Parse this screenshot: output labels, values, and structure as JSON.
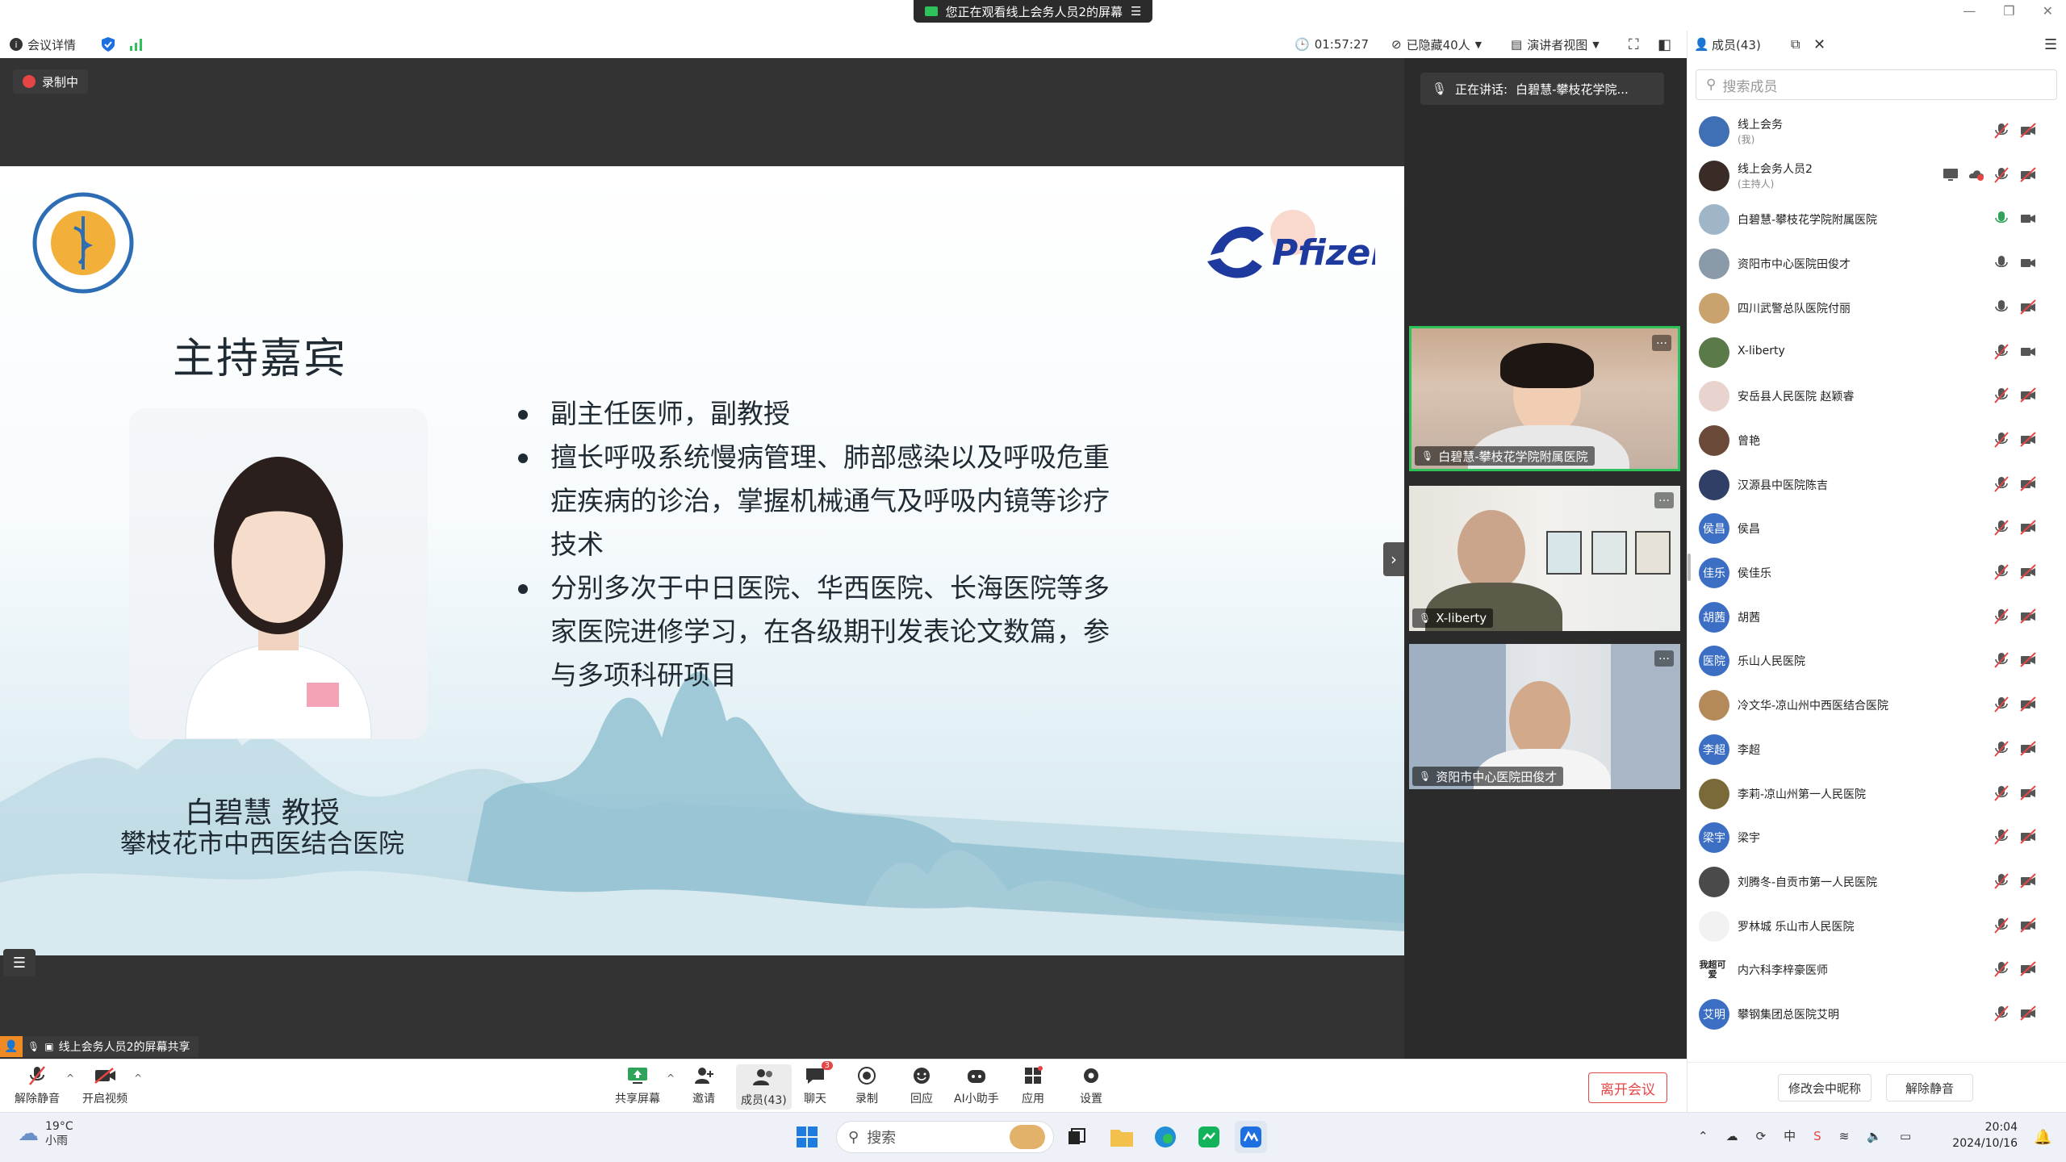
{
  "share_banner": {
    "text": "您正在观看线上会务人员2的屏幕",
    "menu_icon": "menu-icon"
  },
  "meeting_bar": {
    "info": "会议详情",
    "timer": "01:57:27",
    "hidden": "已隐藏40人",
    "view": "演讲者视图"
  },
  "panel": {
    "title": "成员(43)",
    "search_placeholder": "搜索成员",
    "members": [
      {
        "name": "线上会务",
        "sub": "(我)",
        "avatar": "",
        "color": "#3f6fb5",
        "mic": "muted",
        "cam": "off"
      },
      {
        "name": "线上会务人员2",
        "sub": "(主持人)",
        "avatar": "",
        "color": "#3a2b26",
        "mic": "muted",
        "cam": "off",
        "share": true
      },
      {
        "name": "白碧慧-攀枝花学院附属医院",
        "sub": "",
        "avatar": "",
        "color": "#9fb6c9",
        "mic": "on-green",
        "cam": "on"
      },
      {
        "name": "资阳市中心医院田俊才",
        "sub": "",
        "avatar": "",
        "color": "#8a9aa8",
        "mic": "on",
        "cam": "on"
      },
      {
        "name": "四川武警总队医院付丽",
        "sub": "",
        "avatar": "",
        "color": "#c9a26e",
        "mic": "on",
        "cam": "off"
      },
      {
        "name": "X-liberty",
        "sub": "",
        "avatar": "",
        "color": "#5a7a4a",
        "mic": "muted",
        "cam": "on"
      },
      {
        "name": "安岳县人民医院 赵颖睿",
        "sub": "",
        "avatar": "",
        "color": "#e9d3cf",
        "mic": "muted",
        "cam": "off"
      },
      {
        "name": "曾艳",
        "sub": "",
        "avatar": "",
        "color": "#6b4a3a",
        "mic": "muted",
        "cam": "off"
      },
      {
        "name": "汉源县中医院陈吉",
        "sub": "",
        "avatar": "",
        "color": "#2f3f66",
        "mic": "muted",
        "cam": "off"
      },
      {
        "name": "侯昌",
        "sub": "",
        "avatar": "侯昌",
        "color": "#3c6fc4",
        "mic": "muted",
        "cam": "off"
      },
      {
        "name": "侯佳乐",
        "sub": "",
        "avatar": "佳乐",
        "color": "#3c6fc4",
        "mic": "muted",
        "cam": "off"
      },
      {
        "name": "胡茜",
        "sub": "",
        "avatar": "胡茜",
        "color": "#3c6fc4",
        "mic": "muted",
        "cam": "off"
      },
      {
        "name": "乐山人民医院",
        "sub": "",
        "avatar": "医院",
        "color": "#3c6fc4",
        "mic": "muted",
        "cam": "off"
      },
      {
        "name": "冷文华-凉山州中西医结合医院",
        "sub": "",
        "avatar": "",
        "color": "#b48a5a",
        "mic": "muted",
        "cam": "off"
      },
      {
        "name": "李超",
        "sub": "",
        "avatar": "李超",
        "color": "#3c6fc4",
        "mic": "muted",
        "cam": "off"
      },
      {
        "name": "李莉-凉山州第一人民医院",
        "sub": "",
        "avatar": "",
        "color": "#7a6a3a",
        "mic": "muted",
        "cam": "off"
      },
      {
        "name": "梁宇",
        "sub": "",
        "avatar": "梁宇",
        "color": "#3c6fc4",
        "mic": "muted",
        "cam": "off"
      },
      {
        "name": "刘腾冬-自贡市第一人民医院",
        "sub": "",
        "avatar": "",
        "color": "#4a4a4a",
        "mic": "muted",
        "cam": "off"
      },
      {
        "name": "罗林城 乐山市人民医院",
        "sub": "",
        "avatar": "",
        "color": "#f2f2f2",
        "mic": "muted",
        "cam": "off"
      },
      {
        "name": "内六科李梓豪医师",
        "sub": "",
        "avatar": "我超可爱",
        "color": "#ffffff",
        "mic": "muted",
        "cam": "off"
      },
      {
        "name": "攀钢集团总医院艾明",
        "sub": "",
        "avatar": "艾明",
        "color": "#3c6fc4",
        "mic": "muted",
        "cam": "off"
      }
    ],
    "rename_btn": "修改会中昵称",
    "unmute_btn": "解除静音"
  },
  "stage": {
    "recording": "录制中",
    "speaking_prefix": "正在讲话:",
    "speaking_name": "白碧慧-攀枝花学院...",
    "share_label": "线上会务人员2的屏幕共享",
    "tiles": [
      {
        "name": "白碧慧-攀枝花学院附属医院"
      },
      {
        "name": "X-liberty"
      },
      {
        "name": "资阳市中心医院田俊才"
      }
    ]
  },
  "slide": {
    "title": "主持嘉宾",
    "bullets": [
      "副主任医师，副教授",
      "擅长呼吸系统慢病管理、肺部感染以及呼吸危重症疾病的诊治，掌握机械通气及呼吸内镜等诊疗技术",
      "分别多次于中日医院、华西医院、长海医院等多家医院进修学习，在各级期刊发表论文数篇，参与多项科研项目"
    ],
    "name": "白碧慧 教授",
    "hospital": "攀枝花市中西医结合医院",
    "brand": "Pfizer"
  },
  "toolbar": {
    "unmute": "解除静音",
    "video": "开启视频",
    "share": "共享屏幕",
    "invite": "邀请",
    "members": "成员(43)",
    "chat": "聊天",
    "chat_badge": "3",
    "record": "录制",
    "reactions": "回应",
    "ai": "AI小助手",
    "apps": "应用",
    "settings": "设置",
    "leave": "离开会议"
  },
  "taskbar": {
    "temp": "19°C",
    "weather": "小雨",
    "search": "搜索",
    "time": "20:04",
    "date": "2024/10/16"
  }
}
